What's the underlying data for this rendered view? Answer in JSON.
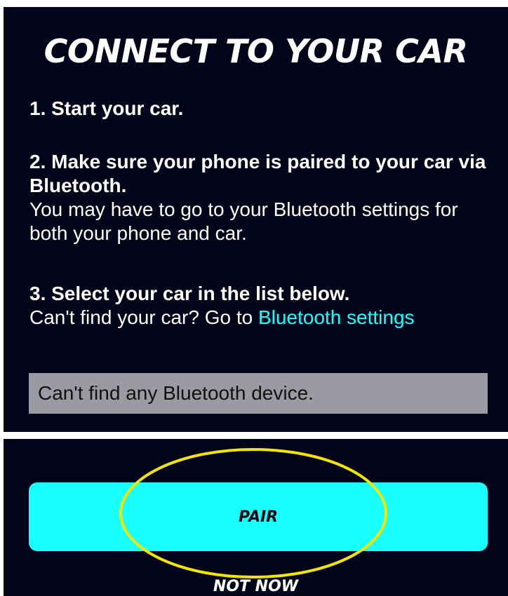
{
  "screen": {
    "title": "CONNECT TO YOUR CAR"
  },
  "steps": [
    {
      "heading": "1. Start your car."
    },
    {
      "heading": "2. Make sure your phone is paired to your car via Bluetooth.",
      "body": "You may have to go to your Bluetooth settings for both your phone and car."
    },
    {
      "heading": "3. Select your car in the list below.",
      "body_prefix": "Can't find your car? Go to ",
      "link_label": "Bluetooth settings"
    }
  ],
  "device_list": {
    "empty_message": "Can't find any Bluetooth device."
  },
  "actions": {
    "pair_label": "PAIR",
    "not_now_label": "NOT NOW"
  },
  "colors": {
    "background": "#020419",
    "accent": "#19fefe",
    "link": "#18ffff",
    "device_box": "#9a9aa3",
    "highlight": "#f2e600"
  }
}
